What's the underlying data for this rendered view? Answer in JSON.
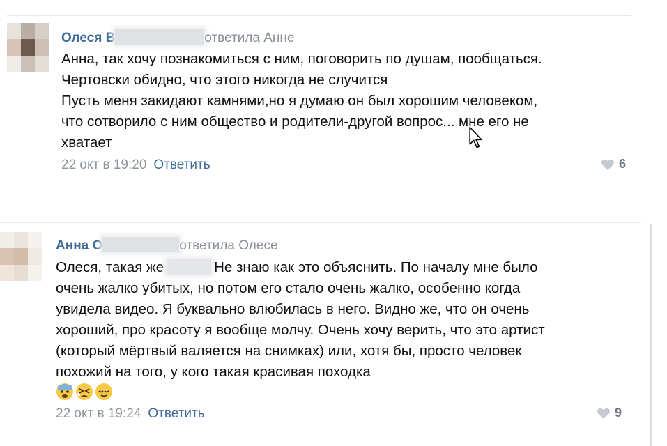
{
  "comments": [
    {
      "author": "Олеся В",
      "replied_to": "ответила Анне",
      "lines": [
        "Анна, так хочу познакомиться с ним, поговорить по душам, пообщаться.",
        "Чертовски обидно, что этого никогда не случится",
        "Пусть меня закидают камнями,но я думаю он был хорошим человеком,",
        "что сотворило с ним общество и родители-другой вопрос... мне его не",
        "хватает"
      ],
      "date": "22 окт в 19:20",
      "reply_label": "Ответить",
      "likes": "6"
    },
    {
      "author": "Анна О",
      "replied_to": "ответила Олесе",
      "line1_before": "Олеся, такая же",
      "line1_after": "Не знаю как это объяснить. По началу мне было",
      "lines": [
        "очень жалко убитых, но потом его стало очень жалко, особенно когда",
        "увидела видео. Я буквально влюбилась в него. Видно же, что он очень",
        "хороший, про красоту я вообще молчу. Очень хочу верить, что это артист",
        "(который мёртвый валяется на снимках) или, хотя бы, просто человек",
        "похожий на того, у кого такая красивая походка"
      ],
      "emojis": [
        "anxious-face-emoji",
        "tired-face-emoji",
        "relieved-face-emoji"
      ],
      "date": "22 окт в 19:24",
      "reply_label": "Ответить",
      "likes": "9"
    }
  ],
  "colors": {
    "author": "#3d6b9b",
    "muted": "#8f959c",
    "separator": "#e7e8ec",
    "like": "#6f7780"
  }
}
